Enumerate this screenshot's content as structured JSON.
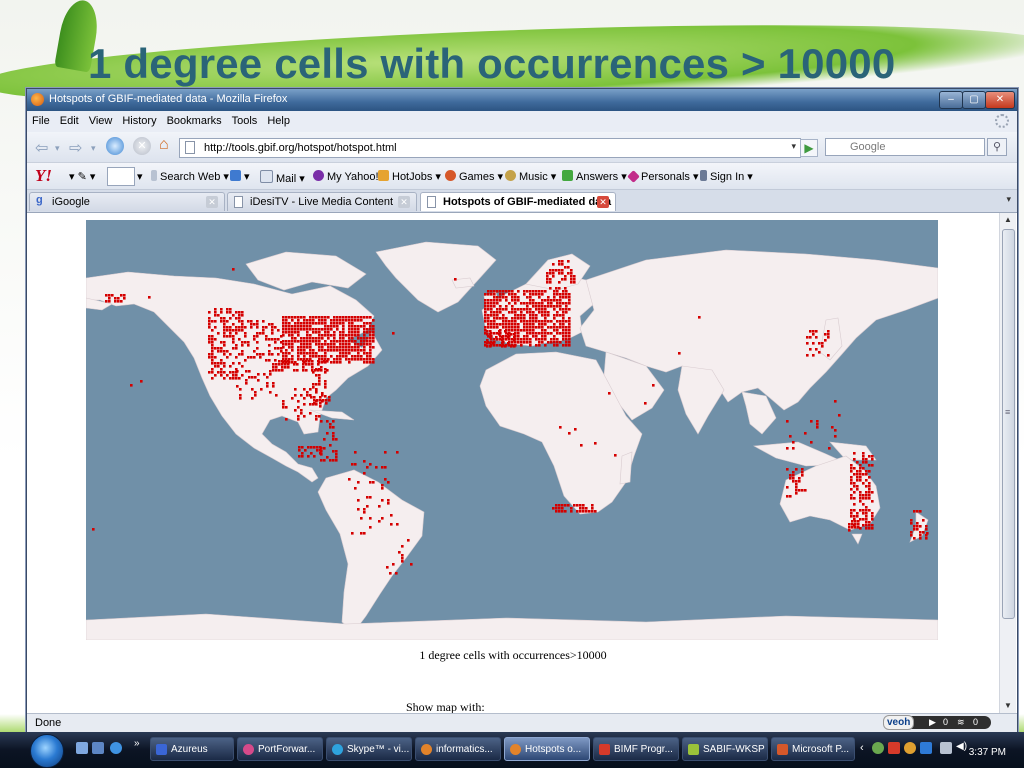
{
  "slide": {
    "title": "1 degree cells with occurrences > 10000"
  },
  "window": {
    "title": "Hotspots of GBIF-mediated data - Mozilla Firefox",
    "buttons": {
      "minimize": "–",
      "maximize": "▢",
      "close": "✕"
    }
  },
  "menu": [
    "File",
    "Edit",
    "View",
    "History",
    "Bookmarks",
    "Tools",
    "Help"
  ],
  "nav": {
    "url": "http://tools.gbif.org/hotspot/hotspot.html",
    "search_placeholder": "Google",
    "search_engine_glyph": "G"
  },
  "yahoo_toolbar": {
    "logo": "Y!",
    "items": [
      "Search Web",
      "Mail",
      "My Yahoo!",
      "HotJobs",
      "Games",
      "Music",
      "Answers",
      "Personals",
      "Sign In"
    ]
  },
  "tabs": [
    {
      "label": "iGoogle",
      "active": false
    },
    {
      "label": "iDesiTV - Live Media Content",
      "active": false
    },
    {
      "label": "Hotspots of GBIF-mediated data",
      "active": true
    }
  ],
  "page": {
    "caption": "1 degree cells with occurrences>10000",
    "show_map_label": "Show map with:"
  },
  "map_colors": {
    "ocean": "#7090a8",
    "land": "#f5eeef",
    "hotspot": "#d40000"
  },
  "status": {
    "text": "Done",
    "veoh_logo": "veoh",
    "veoh_counts": [
      "0",
      "0"
    ]
  },
  "taskbar": {
    "items": [
      {
        "label": "Azureus",
        "active": false
      },
      {
        "label": "PortForwar...",
        "active": false
      },
      {
        "label": "Skype™ - vi...",
        "active": false
      },
      {
        "label": "informatics...",
        "active": false
      },
      {
        "label": "Hotspots o...",
        "active": true
      },
      {
        "label": "BIMF Progr...",
        "active": false
      },
      {
        "label": "SABIF-WKSP",
        "active": false
      },
      {
        "label": "Microsoft P...",
        "active": false
      }
    ],
    "clock": "3:37 PM"
  }
}
